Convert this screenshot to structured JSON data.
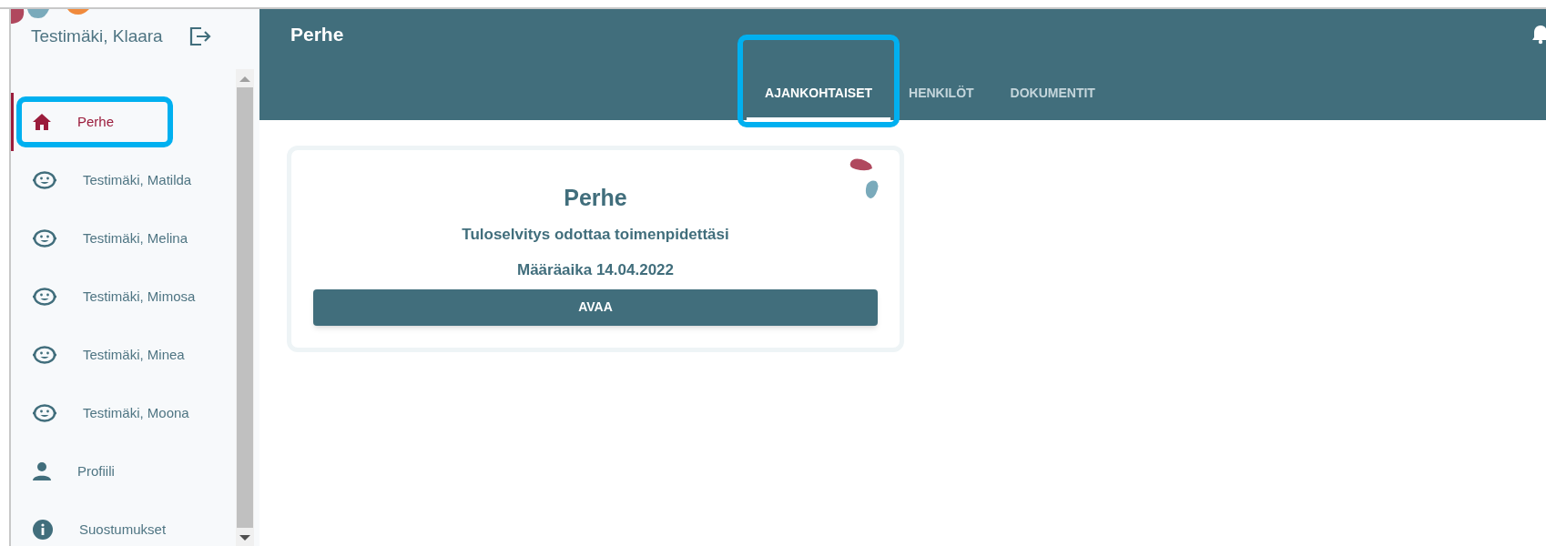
{
  "sidebar": {
    "user_name": "Testimäki, Klaara",
    "items": [
      {
        "kind": "home",
        "label": "Perhe",
        "selected": true,
        "highlighted": true
      },
      {
        "kind": "child",
        "label": "Testimäki, Matilda",
        "selected": false,
        "highlighted": false
      },
      {
        "kind": "child",
        "label": "Testimäki, Melina",
        "selected": false,
        "highlighted": false
      },
      {
        "kind": "child",
        "label": "Testimäki, Mimosa",
        "selected": false,
        "highlighted": false
      },
      {
        "kind": "child",
        "label": "Testimäki, Minea",
        "selected": false,
        "highlighted": false
      },
      {
        "kind": "child",
        "label": "Testimäki, Moona",
        "selected": false,
        "highlighted": false
      },
      {
        "kind": "person",
        "label": "Profiili",
        "selected": false,
        "highlighted": false
      },
      {
        "kind": "info",
        "label": "Suostumukset",
        "selected": false,
        "highlighted": false
      }
    ]
  },
  "header": {
    "title": "Perhe",
    "tabs": [
      {
        "label": "AJANKOHTAISET",
        "selected": true,
        "highlighted": true
      },
      {
        "label": "HENKILÖT",
        "selected": false,
        "highlighted": false
      },
      {
        "label": "DOKUMENTIT",
        "selected": false,
        "highlighted": false
      }
    ]
  },
  "card": {
    "title": "Perhe",
    "message": "Tuloselvitys odottaa toimenpidettäsi",
    "deadline": "Määräaika 14.04.2022",
    "button": "AVAA"
  }
}
